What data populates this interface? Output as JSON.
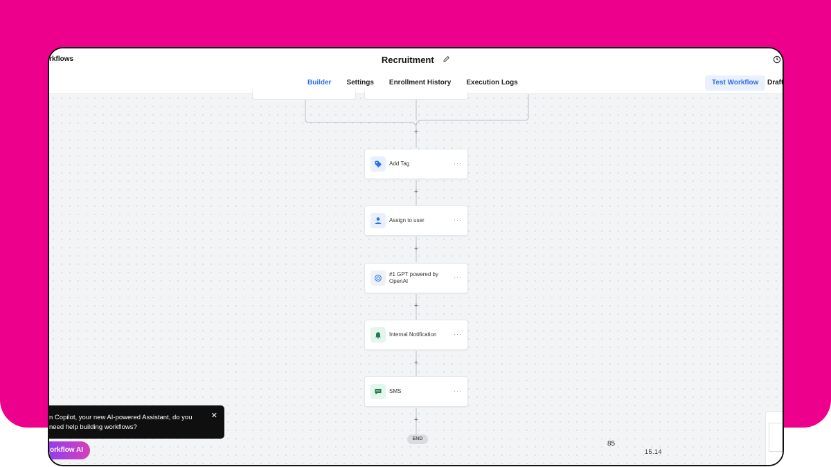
{
  "header": {
    "back_label": "orkflows",
    "title": "Recruitment"
  },
  "tabs": [
    {
      "label": "Builder",
      "active": true
    },
    {
      "label": "Settings"
    },
    {
      "label": "Enrollment History"
    },
    {
      "label": "Execution Logs"
    }
  ],
  "toolbar": {
    "test_label": "Test Workflow",
    "draft_label": "Draft"
  },
  "nodes": [
    {
      "label": "Add Tag",
      "icon": "tag-icon"
    },
    {
      "label": "Assign to user",
      "icon": "user-assign-icon"
    },
    {
      "label": "#1 GPT powered by OpenAI",
      "icon": "openai-icon"
    },
    {
      "label": "Internal Notification",
      "icon": "bell-icon"
    },
    {
      "label": "SMS",
      "icon": "sms-icon"
    }
  ],
  "add_step_symbol": "+",
  "node_menu_symbol": "···",
  "end_label": "END",
  "canvas_numbers": {
    "a": "85",
    "b": "15.14"
  },
  "copilot": {
    "message": "n Copilot, your new AI-powered Assistant, do you need help building workflows?",
    "close_symbol": "✕",
    "button_label": "orkflow AI"
  },
  "colors": {
    "accent": "#2f6fe4",
    "frame_bg": "#ec008c",
    "sms_green": "#1e7d4f"
  }
}
